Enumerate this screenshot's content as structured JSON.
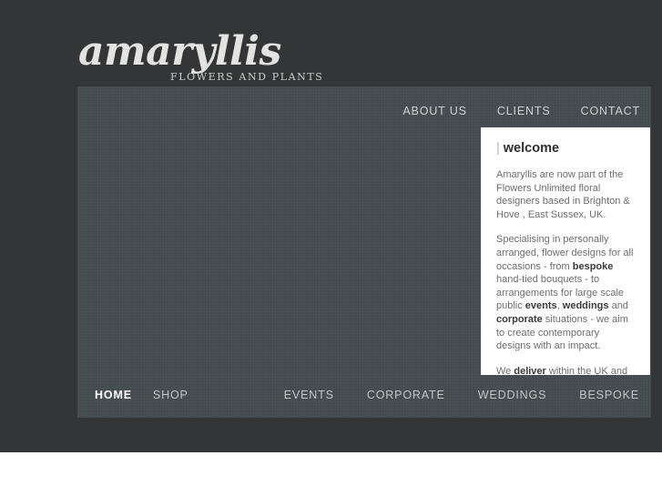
{
  "site": {
    "logo_wordmark": "amaryllis",
    "logo_tagline": "FLOWERS AND PLANTS"
  },
  "top_nav": {
    "items": [
      {
        "label": "ABOUT US"
      },
      {
        "label": "CLIENTS"
      },
      {
        "label": "CONTACT"
      }
    ]
  },
  "welcome_card": {
    "heading_bar": "|",
    "heading": "welcome",
    "paragraphs": [
      {
        "runs": [
          {
            "text": "Amaryllis are now part of the Flowers Unlimited floral designers based in Brighton & Hove , East Sussex, UK.",
            "bold": false
          }
        ]
      },
      {
        "runs": [
          {
            "text": "Specialising in personally arranged, flower designs for all occasions - from ",
            "bold": false
          },
          {
            "text": "bespoke",
            "bold": true
          },
          {
            "text": " hand-tied bouquets - to arrangements for large scale public ",
            "bold": false
          },
          {
            "text": "events",
            "bold": true
          },
          {
            "text": ", ",
            "bold": false
          },
          {
            "text": "weddings",
            "bold": true
          },
          {
            "text": " and ",
            "bold": false
          },
          {
            "text": "corporate",
            "bold": true
          },
          {
            "text": " situations - we aim to create contemporary designs with an impact.",
            "bold": false
          }
        ]
      },
      {
        "runs": [
          {
            "text": "We ",
            "bold": false
          },
          {
            "text": "deliver",
            "bold": true
          },
          {
            "text": " within the UK and also Internationally.",
            "bold": false
          }
        ]
      }
    ]
  },
  "bottom_nav": {
    "left_items": [
      {
        "label": "HOME",
        "active": true
      },
      {
        "label": "SHOP",
        "active": false
      }
    ],
    "right_items": [
      {
        "label": "EVENTS",
        "active": false
      },
      {
        "label": "CORPORATE",
        "active": false
      },
      {
        "label": "WEDDINGS",
        "active": false
      },
      {
        "label": "BESPOKE",
        "active": false
      }
    ]
  },
  "colors": {
    "page_background": "#343537",
    "content_panel": "#454d51",
    "card_background": "#ffffff",
    "nav_text": "#cfd2d2",
    "active_nav_text": "#ffffff",
    "body_text": "#6e6e6e",
    "heading_text": "#2f2f2f",
    "logo_text": "#e3e3e1"
  }
}
